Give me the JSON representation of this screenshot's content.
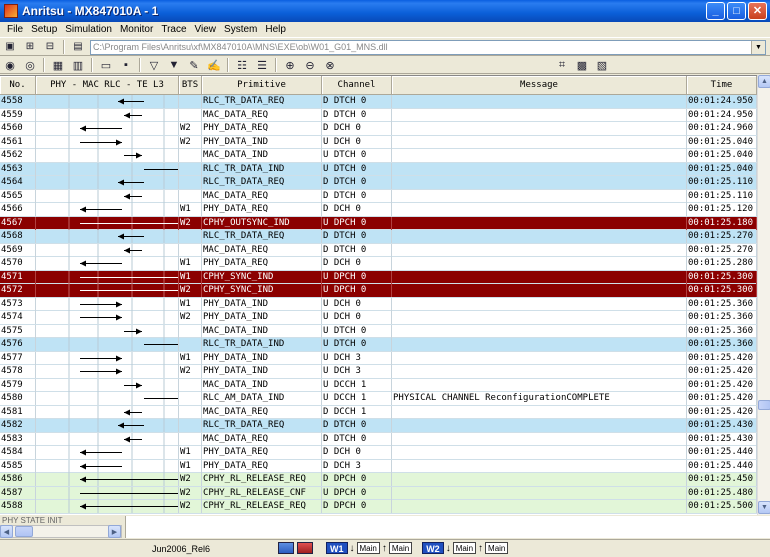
{
  "window": {
    "title": "Anritsu - MX847010A - 1"
  },
  "menu": [
    "File",
    "Setup",
    "Simulation",
    "Monitor",
    "Trace",
    "View",
    "System",
    "Help"
  ],
  "path": {
    "value": "C:\\Program Files\\Anritsu\\xf\\MX847010A\\MNS\\EXE\\ob\\W01_G01_MNS.dll"
  },
  "table": {
    "headers": {
      "no": "No.",
      "flow": "PHY  -  MAC RLC  -  TE  L3",
      "bts": "BTS",
      "primitive": "Primitive",
      "channel": "Channel",
      "message": "Message",
      "time": "Time"
    },
    "rows": [
      {
        "no": "4558",
        "bts": "",
        "primitive": "RLC_TR_DATA_REQ",
        "channel": "D DTCH 0",
        "message": "",
        "time": "00:01:24.950",
        "style": "blue",
        "flow": "rlc-mac-left"
      },
      {
        "no": "4559",
        "bts": "",
        "primitive": "MAC_DATA_REQ",
        "channel": "D DTCH 0",
        "message": "",
        "time": "00:01:24.950",
        "style": "white",
        "flow": "mac-left-short"
      },
      {
        "no": "4560",
        "bts": "W2",
        "primitive": "PHY_DATA_REQ",
        "channel": "D DCH 0",
        "message": "",
        "time": "00:01:24.960",
        "style": "white",
        "flow": "phy-left"
      },
      {
        "no": "4561",
        "bts": "W2",
        "primitive": "PHY_DATA_IND",
        "channel": "U DCH 0",
        "message": "",
        "time": "00:01:25.040",
        "style": "white",
        "flow": "phy-right"
      },
      {
        "no": "4562",
        "bts": "",
        "primitive": "MAC_DATA_IND",
        "channel": "U DTCH 0",
        "message": "",
        "time": "00:01:25.040",
        "style": "white",
        "flow": "mac-right-short"
      },
      {
        "no": "4563",
        "bts": "",
        "primitive": "RLC_TR_DATA_IND",
        "channel": "U DTCH 0",
        "message": "",
        "time": "00:01:25.040",
        "style": "blue",
        "flow": "rlc-right"
      },
      {
        "no": "4564",
        "bts": "",
        "primitive": "RLC_TR_DATA_REQ",
        "channel": "D DTCH 0",
        "message": "",
        "time": "00:01:25.110",
        "style": "blue",
        "flow": "rlc-mac-left"
      },
      {
        "no": "4565",
        "bts": "",
        "primitive": "MAC_DATA_REQ",
        "channel": "D DTCH 0",
        "message": "",
        "time": "00:01:25.110",
        "style": "white",
        "flow": "mac-left-short"
      },
      {
        "no": "4566",
        "bts": "W1",
        "primitive": "PHY_DATA_REQ",
        "channel": "D DCH 0",
        "message": "",
        "time": "00:01:25.120",
        "style": "white",
        "flow": "phy-left"
      },
      {
        "no": "4567",
        "bts": "W2",
        "primitive": "CPHY_OUTSYNC_IND",
        "channel": "U DPCH 0",
        "message": "",
        "time": "00:01:25.180",
        "style": "dark",
        "flow": "cphy-right"
      },
      {
        "no": "4568",
        "bts": "",
        "primitive": "RLC_TR_DATA_REQ",
        "channel": "D DTCH 0",
        "message": "",
        "time": "00:01:25.270",
        "style": "blue",
        "flow": "rlc-mac-left"
      },
      {
        "no": "4569",
        "bts": "",
        "primitive": "MAC_DATA_REQ",
        "channel": "D DTCH 0",
        "message": "",
        "time": "00:01:25.270",
        "style": "white",
        "flow": "mac-left-short"
      },
      {
        "no": "4570",
        "bts": "W1",
        "primitive": "PHY_DATA_REQ",
        "channel": "D DCH 0",
        "message": "",
        "time": "00:01:25.280",
        "style": "white",
        "flow": "phy-left"
      },
      {
        "no": "4571",
        "bts": "W1",
        "primitive": "CPHY_SYNC_IND",
        "channel": "U DPCH 0",
        "message": "",
        "time": "00:01:25.300",
        "style": "dark",
        "flow": "cphy-right"
      },
      {
        "no": "4572",
        "bts": "W2",
        "primitive": "CPHY_SYNC_IND",
        "channel": "U DPCH 0",
        "message": "",
        "time": "00:01:25.300",
        "style": "dark",
        "flow": "cphy-right"
      },
      {
        "no": "4573",
        "bts": "W1",
        "primitive": "PHY_DATA_IND",
        "channel": "U DCH 0",
        "message": "",
        "time": "00:01:25.360",
        "style": "white",
        "flow": "phy-right"
      },
      {
        "no": "4574",
        "bts": "W2",
        "primitive": "PHY_DATA_IND",
        "channel": "U DCH 0",
        "message": "",
        "time": "00:01:25.360",
        "style": "white",
        "flow": "phy-right"
      },
      {
        "no": "4575",
        "bts": "",
        "primitive": "MAC_DATA_IND",
        "channel": "U DTCH 0",
        "message": "",
        "time": "00:01:25.360",
        "style": "white",
        "flow": "mac-right-short"
      },
      {
        "no": "4576",
        "bts": "",
        "primitive": "RLC_TR_DATA_IND",
        "channel": "U DTCH 0",
        "message": "",
        "time": "00:01:25.360",
        "style": "blue",
        "flow": "rlc-right"
      },
      {
        "no": "4577",
        "bts": "W1",
        "primitive": "PHY_DATA_IND",
        "channel": "U DCH 3",
        "message": "",
        "time": "00:01:25.420",
        "style": "white",
        "flow": "phy-right"
      },
      {
        "no": "4578",
        "bts": "W2",
        "primitive": "PHY_DATA_IND",
        "channel": "U DCH 3",
        "message": "",
        "time": "00:01:25.420",
        "style": "white",
        "flow": "phy-right"
      },
      {
        "no": "4579",
        "bts": "",
        "primitive": "MAC_DATA_IND",
        "channel": "U DCCH 1",
        "message": "",
        "time": "00:01:25.420",
        "style": "white",
        "flow": "mac-right-short"
      },
      {
        "no": "4580",
        "bts": "",
        "primitive": "RLC_AM_DATA_IND",
        "channel": "U DCCH 1",
        "message": "PHYSICAL CHANNEL ReconfigurationCOMPLETE",
        "time": "00:01:25.420",
        "style": "white",
        "flow": "rlc-l3-right"
      },
      {
        "no": "4581",
        "bts": "",
        "primitive": "MAC_DATA_REQ",
        "channel": "D DCCH 1",
        "message": "",
        "time": "00:01:25.420",
        "style": "white",
        "flow": "mac-left-short"
      },
      {
        "no": "4582",
        "bts": "",
        "primitive": "RLC_TR_DATA_REQ",
        "channel": "D DTCH 0",
        "message": "",
        "time": "00:01:25.430",
        "style": "blue",
        "flow": "rlc-mac-left"
      },
      {
        "no": "4583",
        "bts": "",
        "primitive": "MAC_DATA_REQ",
        "channel": "D DTCH 0",
        "message": "",
        "time": "00:01:25.430",
        "style": "white",
        "flow": "mac-left-short"
      },
      {
        "no": "4584",
        "bts": "W1",
        "primitive": "PHY_DATA_REQ",
        "channel": "D DCH 0",
        "message": "",
        "time": "00:01:25.440",
        "style": "white",
        "flow": "phy-left"
      },
      {
        "no": "4585",
        "bts": "W1",
        "primitive": "PHY_DATA_REQ",
        "channel": "D DCH 3",
        "message": "",
        "time": "00:01:25.440",
        "style": "white",
        "flow": "phy-left"
      },
      {
        "no": "4586",
        "bts": "W2",
        "primitive": "CPHY_RL_RELEASE_REQ",
        "channel": "D DPCH 0",
        "message": "",
        "time": "00:01:25.450",
        "style": "green",
        "flow": "cphy-left"
      },
      {
        "no": "4587",
        "bts": "W2",
        "primitive": "CPHY_RL_RELEASE_CNF",
        "channel": "U DPCH 0",
        "message": "",
        "time": "00:01:25.480",
        "style": "green",
        "flow": "cphy-right"
      },
      {
        "no": "4588",
        "bts": "W2",
        "primitive": "CPHY_RL_RELEASE_REQ",
        "channel": "D DPCH 0",
        "message": "",
        "time": "00:01:25.500",
        "style": "green",
        "flow": "cphy-left"
      }
    ]
  },
  "status_panel": {
    "state_text": "PHY STATE INIT"
  },
  "statusbar": {
    "release": "Jun2006_Rel6",
    "w1": "W1",
    "w2": "W2",
    "main": "Main"
  }
}
